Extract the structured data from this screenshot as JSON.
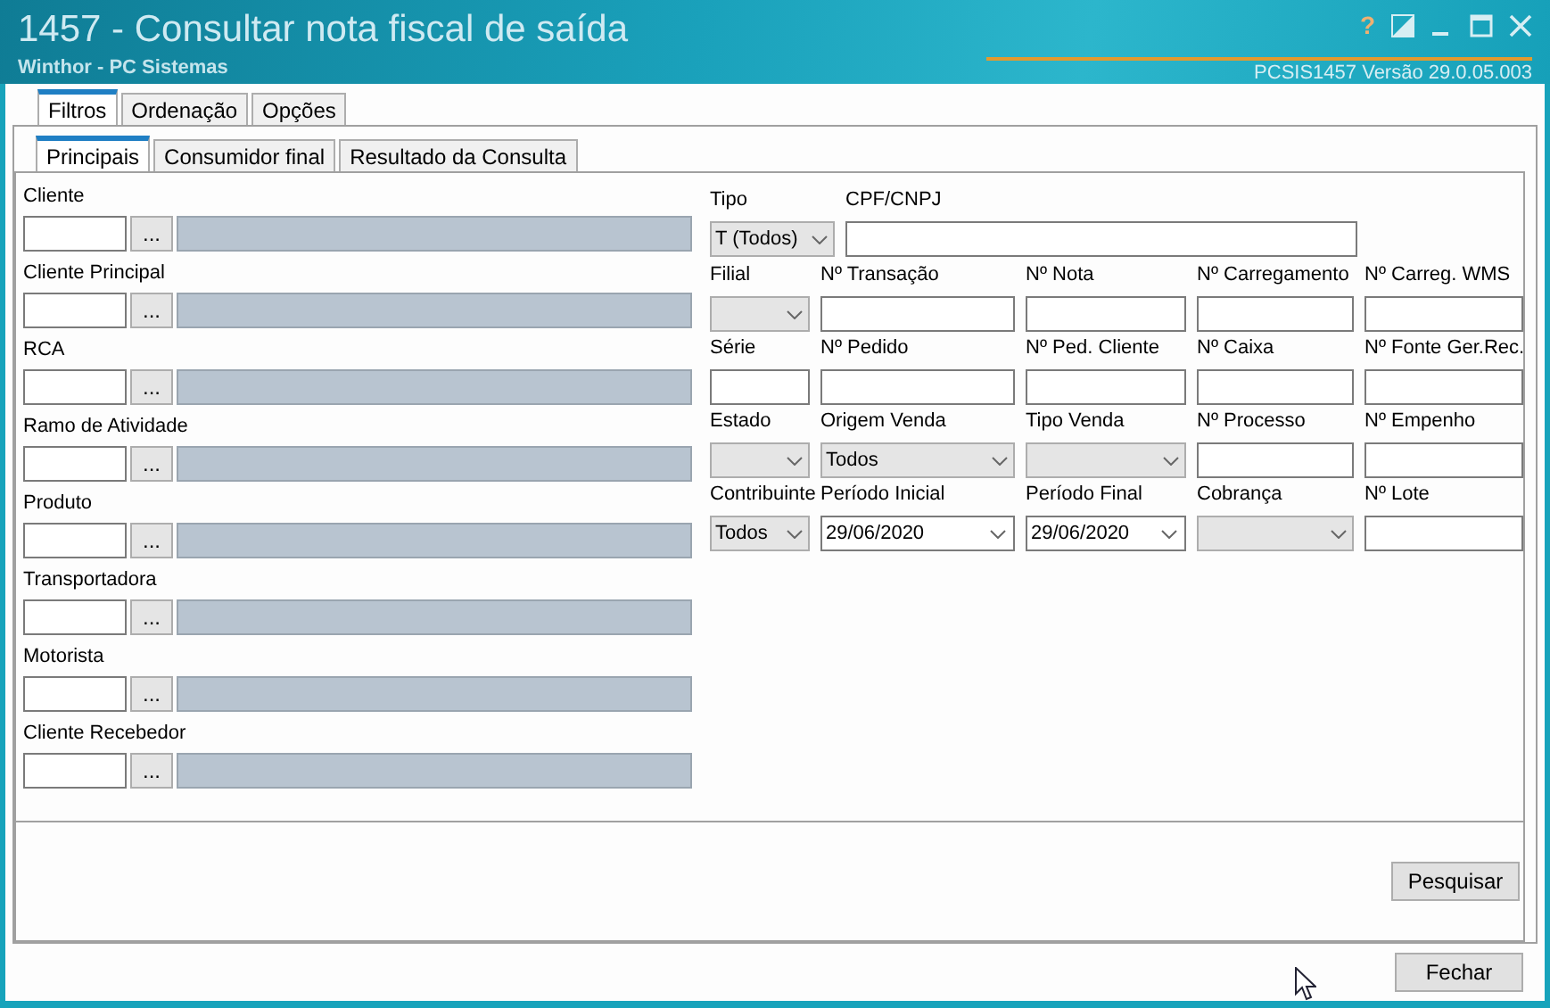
{
  "window": {
    "title": "1457 - Consultar nota fiscal de saída",
    "subtitle": "Winthor - PC Sistemas",
    "version": "PCSIS1457  Versão  29.0.05.003",
    "help": "?"
  },
  "tabs": [
    {
      "label": "Filtros",
      "selected": true
    },
    {
      "label": "Ordenação",
      "selected": false
    },
    {
      "label": "Opções",
      "selected": false
    }
  ],
  "subtabs": [
    {
      "label": "Principais",
      "selected": true
    },
    {
      "label": "Consumidor final",
      "selected": false
    },
    {
      "label": "Resultado da Consulta",
      "selected": false
    }
  ],
  "lookups": [
    {
      "label": "Cliente"
    },
    {
      "label": "Cliente Principal"
    },
    {
      "label": "RCA"
    },
    {
      "label": "Ramo de Atividade"
    },
    {
      "label": "Produto"
    },
    {
      "label": "Transportadora"
    },
    {
      "label": "Motorista"
    },
    {
      "label": "Cliente Recebedor"
    }
  ],
  "lookup_button": "...",
  "field_rows": [
    [
      {
        "label": "Tipo",
        "kind": "combo",
        "value": "T (Todos)"
      },
      {
        "label": "CPF/CNPJ",
        "kind": "text"
      }
    ],
    [
      {
        "label": "Filial",
        "kind": "combo"
      },
      {
        "label": "Nº Transação",
        "kind": "text"
      },
      {
        "label": "Nº Nota",
        "kind": "text"
      },
      {
        "label": "Nº Carregamento",
        "kind": "text"
      },
      {
        "label": "Nº Carreg. WMS",
        "kind": "text"
      }
    ],
    [
      {
        "label": "Série",
        "kind": "text"
      },
      {
        "label": "Nº Pedido",
        "kind": "text"
      },
      {
        "label": "Nº Ped. Cliente",
        "kind": "text"
      },
      {
        "label": "Nº Caixa",
        "kind": "text"
      },
      {
        "label": "Nº Fonte Ger.Rec.",
        "kind": "text"
      }
    ],
    [
      {
        "label": "Estado",
        "kind": "combo"
      },
      {
        "label": "Origem Venda",
        "kind": "combo",
        "value": "Todos"
      },
      {
        "label": "Tipo Venda",
        "kind": "combo"
      },
      {
        "label": "Nº Processo",
        "kind": "text"
      },
      {
        "label": "Nº Empenho",
        "kind": "text"
      }
    ],
    [
      {
        "label": "Contribuinte",
        "kind": "combo",
        "value": "Todos"
      },
      {
        "label": "Período Inicial",
        "kind": "date",
        "value": "29/06/2020"
      },
      {
        "label": "Período Final",
        "kind": "date",
        "value": "29/06/2020"
      },
      {
        "label": "Cobrança",
        "kind": "combo"
      },
      {
        "label": "Nº Lote",
        "kind": "text"
      }
    ]
  ],
  "search_button": "Pesquisar",
  "close_button": "Fechar"
}
